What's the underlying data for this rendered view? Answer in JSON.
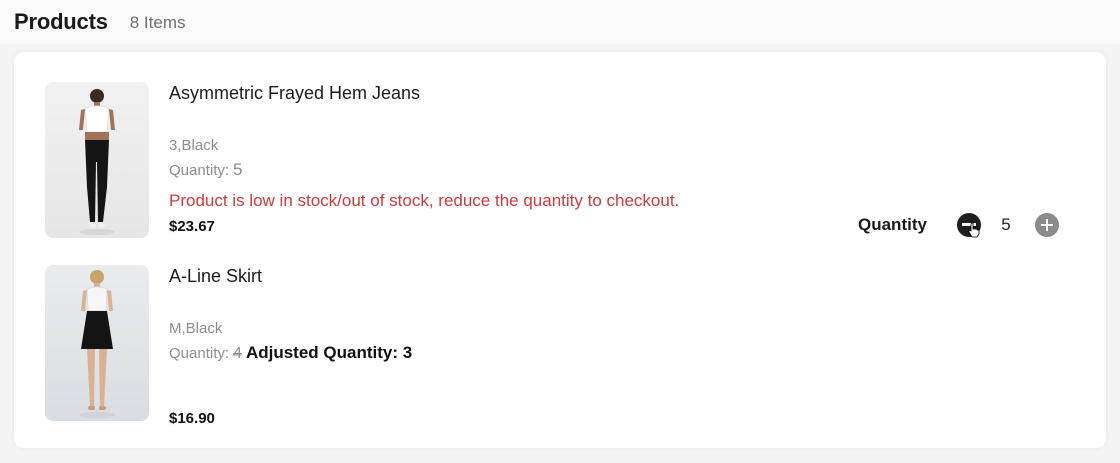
{
  "header": {
    "title": "Products",
    "count": "8 Items"
  },
  "items": [
    {
      "name": "Asymmetric Frayed Hem Jeans",
      "variant": "3,Black",
      "quantity_label": "Quantity:",
      "quantity": "5",
      "warning": "Product is low in stock/out of stock, reduce the quantity to checkout.",
      "price": "$23.67",
      "image": "model-in-black-jeans"
    },
    {
      "name": "A-Line Skirt",
      "variant": "M,Black",
      "quantity_label": "Quantity:",
      "quantity_old": "4",
      "adjusted_quantity": "Adjusted Quantity: 3",
      "price": "$16.90",
      "image": "model-in-black-skirt"
    }
  ],
  "stepper": {
    "label": "Quantity",
    "value": "5",
    "minus_icon": "minus-circle-icon",
    "plus_icon": "plus-circle-icon"
  },
  "colors": {
    "warning": "#d03a3a",
    "minus_button": "#1f1f1f",
    "plus_button": "#8a8a8a"
  }
}
